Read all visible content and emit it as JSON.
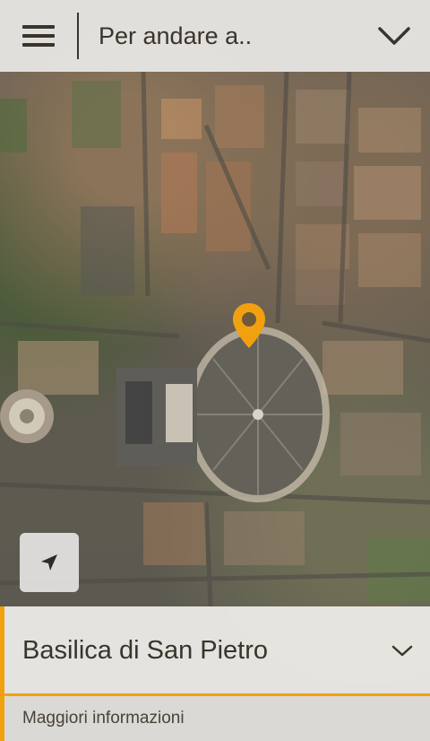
{
  "header": {
    "goto_label": "Per andare a..",
    "menu_icon": "hamburger-menu-icon",
    "dropdown_icon": "chevron-down-icon"
  },
  "map": {
    "marker_icon": "location-pin-icon",
    "locate_icon": "navigation-arrow-icon",
    "accent_color": "#f1a10f"
  },
  "place_panel": {
    "title": "Basilica di San Pietro",
    "expand_icon": "chevron-down-icon",
    "more_info_label": "Maggiori informazioni"
  }
}
